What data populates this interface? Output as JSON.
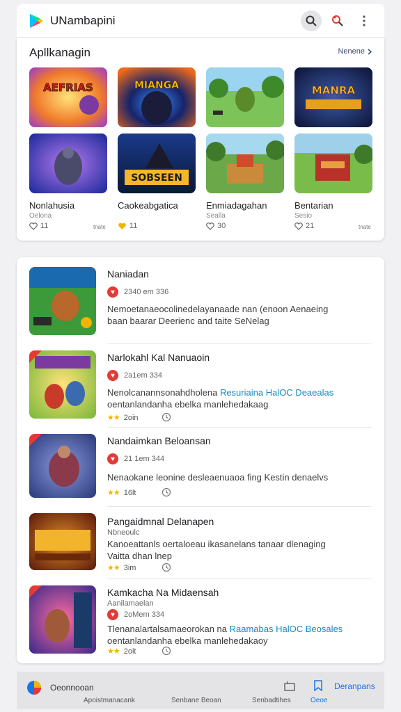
{
  "header": {
    "title": "UNambapini"
  },
  "section": {
    "title": "Apllkanagin",
    "see_more": "Nenene"
  },
  "games": [
    {
      "name": "Nonlahusia",
      "sub": "Oelona",
      "count": "11",
      "badge": "tnate"
    },
    {
      "name": "Caokeabgatica",
      "sub": "",
      "count": "11",
      "badge": ""
    },
    {
      "name": "Enmiadagahan",
      "sub": "Sealla",
      "count": "30",
      "badge": ""
    },
    {
      "name": "Bentarian",
      "sub": "Sesio",
      "count": "21",
      "badge": "tnate"
    }
  ],
  "thumb_texts": [
    "AEFRIAS",
    "MIANGA",
    "",
    "MANRA",
    "",
    "SOBSEEN",
    "",
    ""
  ],
  "list": [
    {
      "title": "Naniadan",
      "meta": "2340 em 336",
      "desc1": "Nemoetanaeocolinedelayanaade nan (enoon Aenaeing",
      "desc2": "baan baarar Deerienc and taite SeNelag"
    },
    {
      "title": "Narlokahl Kal Nanuaoin",
      "meta": "2a1em 334",
      "desc1": "Nenolcanannsonahdholena",
      "desc1_link": "Resuriaina HalOC Deaealas",
      "desc2": "oentanlandanha ebelka manlehedakaag",
      "stars": "2oin"
    },
    {
      "title": "Nandaimkan Beloansan",
      "meta": "21 1em 344",
      "desc1": "Nenaokane leonine desleaenuaoa fing Kestin denaelvs",
      "stars": "16lt"
    },
    {
      "title": "Pangaidmnal Delanapen",
      "sub": "Nbneoulc",
      "desc1": "Kanoeattanls oertaloeau ikasanelans tanaar dlenaging",
      "desc2": "Vaitta  dhan  lnep",
      "stars": "3im"
    },
    {
      "title": "Kamkacha Na Midaensah",
      "sub": "Aanilamaelan",
      "meta": "2oMem 334",
      "desc1": "Tlenanalartalsamaeorokan na",
      "desc1_link": "Raamabas HalOC Beosales",
      "desc2": "oentanlandanha ebelka manlehedakaoy",
      "stars": "2oit"
    }
  ],
  "bottom_nav": {
    "main_label": "Oeonnooan",
    "sub1": "Apoistmanacank",
    "sub2": "Senbane Beoan",
    "sub3": "Senbadtihes",
    "sub4": "Oeoe",
    "active_label": "Deranpans"
  },
  "colors": {
    "accent": "#1a73e8",
    "link": "#1a8ac4",
    "star": "#f2b400",
    "badge_red": "#e53935"
  }
}
